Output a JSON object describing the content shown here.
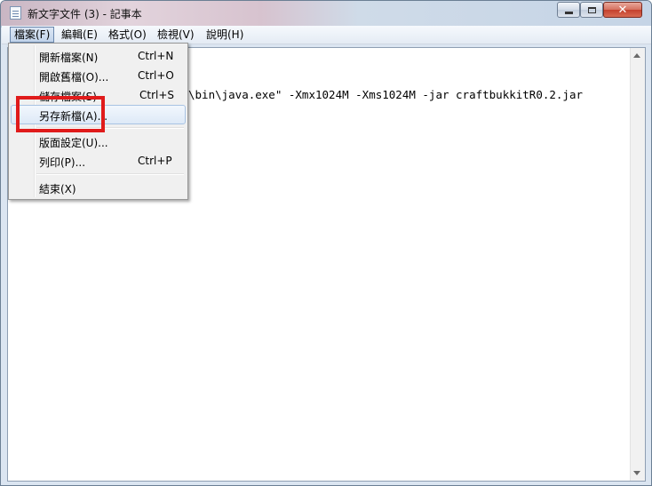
{
  "window": {
    "title": "新文字文件 (3) - 記事本"
  },
  "menubar": {
    "items": [
      "檔案(F)",
      "編輯(E)",
      "格式(O)",
      "檢視(V)",
      "說明(H)"
    ]
  },
  "editor": {
    "content": "\\bin\\java.exe\" -Xmx1024M -Xms1024M -jar craftbukkitR0.2.jar"
  },
  "file_menu": {
    "items": [
      {
        "label": "開新檔案(N)",
        "shortcut": "Ctrl+N"
      },
      {
        "label": "開啟舊檔(O)...",
        "shortcut": "Ctrl+O"
      },
      {
        "label": "儲存檔案(S)",
        "shortcut": "Ctrl+S"
      },
      {
        "label": "另存新檔(A)...",
        "shortcut": ""
      },
      {
        "label": "版面設定(U)...",
        "shortcut": ""
      },
      {
        "label": "列印(P)...",
        "shortcut": "Ctrl+P"
      },
      {
        "label": "結束(X)",
        "shortcut": ""
      }
    ]
  },
  "colors": {
    "highlight": "#e01b1b",
    "close_button": "#c4402d"
  },
  "icons": {
    "app": "notepad-icon",
    "minimize": "minimize-icon",
    "maximize": "maximize-icon",
    "close": "close-icon"
  }
}
